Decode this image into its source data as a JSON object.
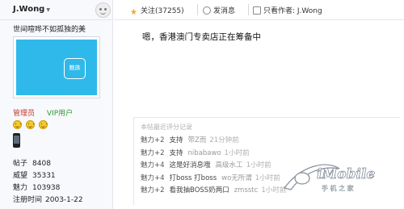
{
  "user": {
    "name": "J.Wong",
    "signature": "世间喧哗不如孤独的美",
    "avatar_logo_text": "魅族",
    "roles": {
      "admin": "管理员",
      "vip": "VIP用户"
    },
    "stats": [
      {
        "label": "帖子",
        "value": "8408"
      },
      {
        "label": "威望",
        "value": "35331"
      },
      {
        "label": "魅力",
        "value": "103938"
      },
      {
        "label": "注册时间",
        "value": "2003-1-22"
      }
    ]
  },
  "actions": {
    "follow": "关注(37255)",
    "message": "发消息",
    "author_only": "只看作者: J.Wong"
  },
  "post": {
    "text": "嗯，香港澳门专卖店正在筹备中"
  },
  "ratings": {
    "title": "本帖最近评分记录",
    "items": [
      {
        "score": "魅力+2",
        "reason": "支持",
        "user": "带Z而",
        "time": "21分钟前"
      },
      {
        "score": "魅力+2",
        "reason": "支持",
        "user": "nibabawo",
        "time": "1小时前"
      },
      {
        "score": "魅力+4",
        "reason": "这是好消息哦",
        "user": "高级水工",
        "time": "1小时前"
      },
      {
        "score": "魅力+4",
        "reason": "打boss 打boss",
        "user": "wo无所谓",
        "time": "1小时前"
      },
      {
        "score": "魅力+2",
        "reason": "看我抽BOSS奶两口",
        "user": "zmsstc",
        "time": "1小时前"
      }
    ]
  },
  "watermark": {
    "brand": "iMobile",
    "sub": "手 机 之 家"
  },
  "colors": {
    "avatar_bg": "#2fb9ea",
    "admin_role": "#c0392b",
    "vip_role": "#2e9a2e",
    "star": "#f5a623"
  }
}
